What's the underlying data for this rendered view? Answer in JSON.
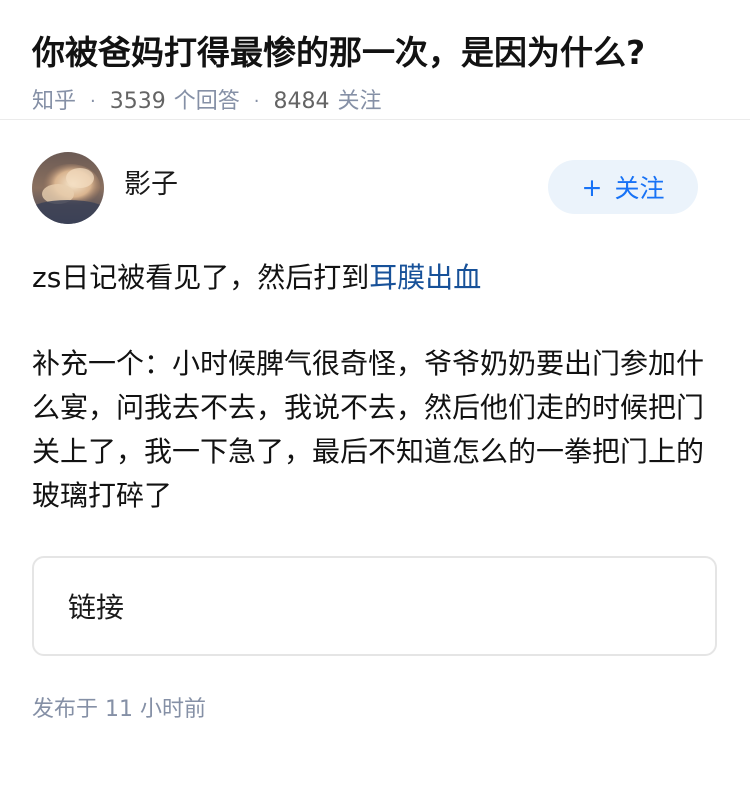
{
  "question": {
    "title": "你被爸妈打得最惨的那一次，是因为什么?",
    "source": "知乎",
    "answer_count": "3539",
    "answer_label": "个回答",
    "follower_count": "8484",
    "follower_label": "关注",
    "separator": "·"
  },
  "answer": {
    "author_name": "影子",
    "follow_button": {
      "icon": "+",
      "label": "关注"
    },
    "paragraph1": {
      "text": "zs日记被看见了，然后打到",
      "link_text": "耳膜出血"
    },
    "paragraph2": "补充一个：小时候脾气很奇怪，爷爷奶奶要出门参加什么宴，问我去不去，我说不去，然后他们走的时候把门关上了，我一下急了，最后不知道怎么的一拳把门上的玻璃打碎了",
    "link_card_label": "链接",
    "published": "发布于  11 小时前"
  },
  "colors": {
    "link": "#175199",
    "meta": "#8590a6",
    "follow_bg": "#ebf3fb",
    "follow_text": "#1772f6"
  }
}
